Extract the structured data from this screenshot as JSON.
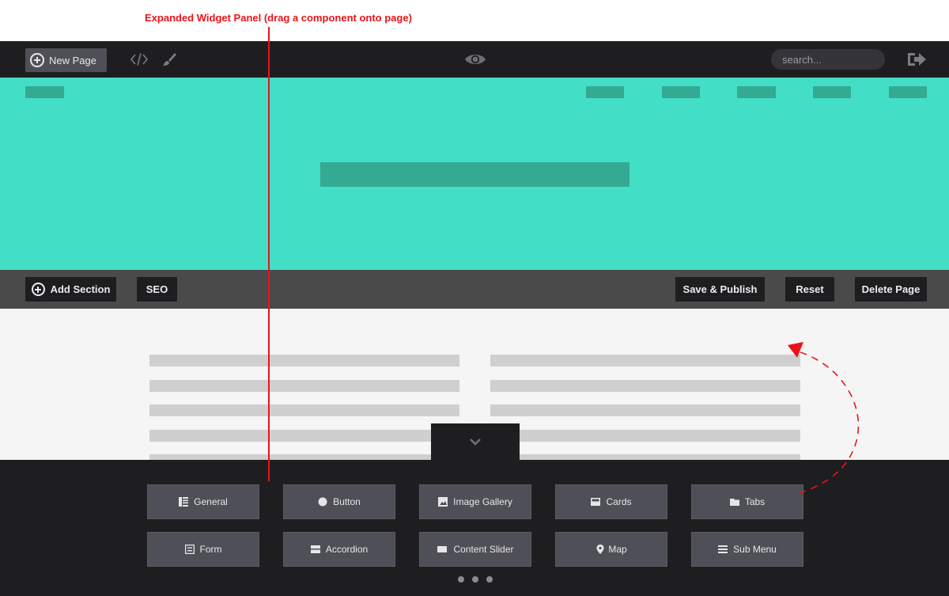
{
  "annotation": {
    "label": "Expanded Widget Panel (drag a component onto page)"
  },
  "toolbar": {
    "new_page_label": "New Page",
    "search_placeholder": "search...",
    "icons": [
      "plus-circle-icon",
      "code-icon",
      "brush-icon",
      "eye-icon",
      "logout-icon"
    ]
  },
  "section_bar": {
    "add_section_label": "Add Section",
    "seo_label": "SEO",
    "save_publish_label": "Save & Publish",
    "reset_label": "Reset",
    "delete_page_label": "Delete Page"
  },
  "widgets": {
    "items": [
      {
        "label": "General",
        "icon": "general-icon"
      },
      {
        "label": "Button",
        "icon": "circle-icon"
      },
      {
        "label": "Image Gallery",
        "icon": "image-icon"
      },
      {
        "label": "Cards",
        "icon": "card-icon"
      },
      {
        "label": "Tabs",
        "icon": "folder-icon"
      },
      {
        "label": "Form",
        "icon": "form-icon"
      },
      {
        "label": "Accordion",
        "icon": "accordion-icon"
      },
      {
        "label": "Content Slider",
        "icon": "slider-icon"
      },
      {
        "label": "Map",
        "icon": "map-pin-icon"
      },
      {
        "label": "Sub Menu",
        "icon": "menu-icon"
      }
    ],
    "page_count": 3
  },
  "colors": {
    "toolbar_bg": "#1e1e21",
    "hero_bg": "#42dfc6",
    "hero_placeholder": "#34aa92",
    "section_bar_bg": "#4a4a4a",
    "content_bg": "#f5f5f5",
    "annotation": "#e8141a",
    "widget_button_bg": "#4f4f57"
  }
}
